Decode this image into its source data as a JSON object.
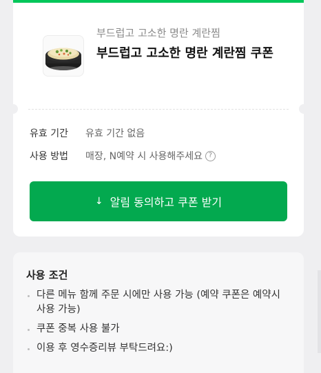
{
  "colors": {
    "accent": "#03c75a",
    "button": "#03a94f",
    "background": "#efeff1"
  },
  "coupon": {
    "store_name": "부드럽고 고소한 명란 계란찜",
    "title": "부드럽고 고소한 명란 계란찜 쿠폰",
    "thumbnail_icon": "steamed-egg-dish-image",
    "validity_label": "유효 기간",
    "validity_value": "유효 기간 없음",
    "usage_label": "사용 방법",
    "usage_value": "매장, N예약 시 사용해주세요",
    "help_icon": "?",
    "download_icon": "↓",
    "download_label": "알림 동의하고 쿠폰 받기"
  },
  "conditions": {
    "title": "사용 조건",
    "items": [
      "다른 메뉴 함께 주문 시에만 사용 가능 (예약 쿠폰은 예약시 사용 가능)",
      "쿠폰 중복 사용 불가",
      "이용 후 영수증리뷰 부탁드려요:)"
    ]
  }
}
